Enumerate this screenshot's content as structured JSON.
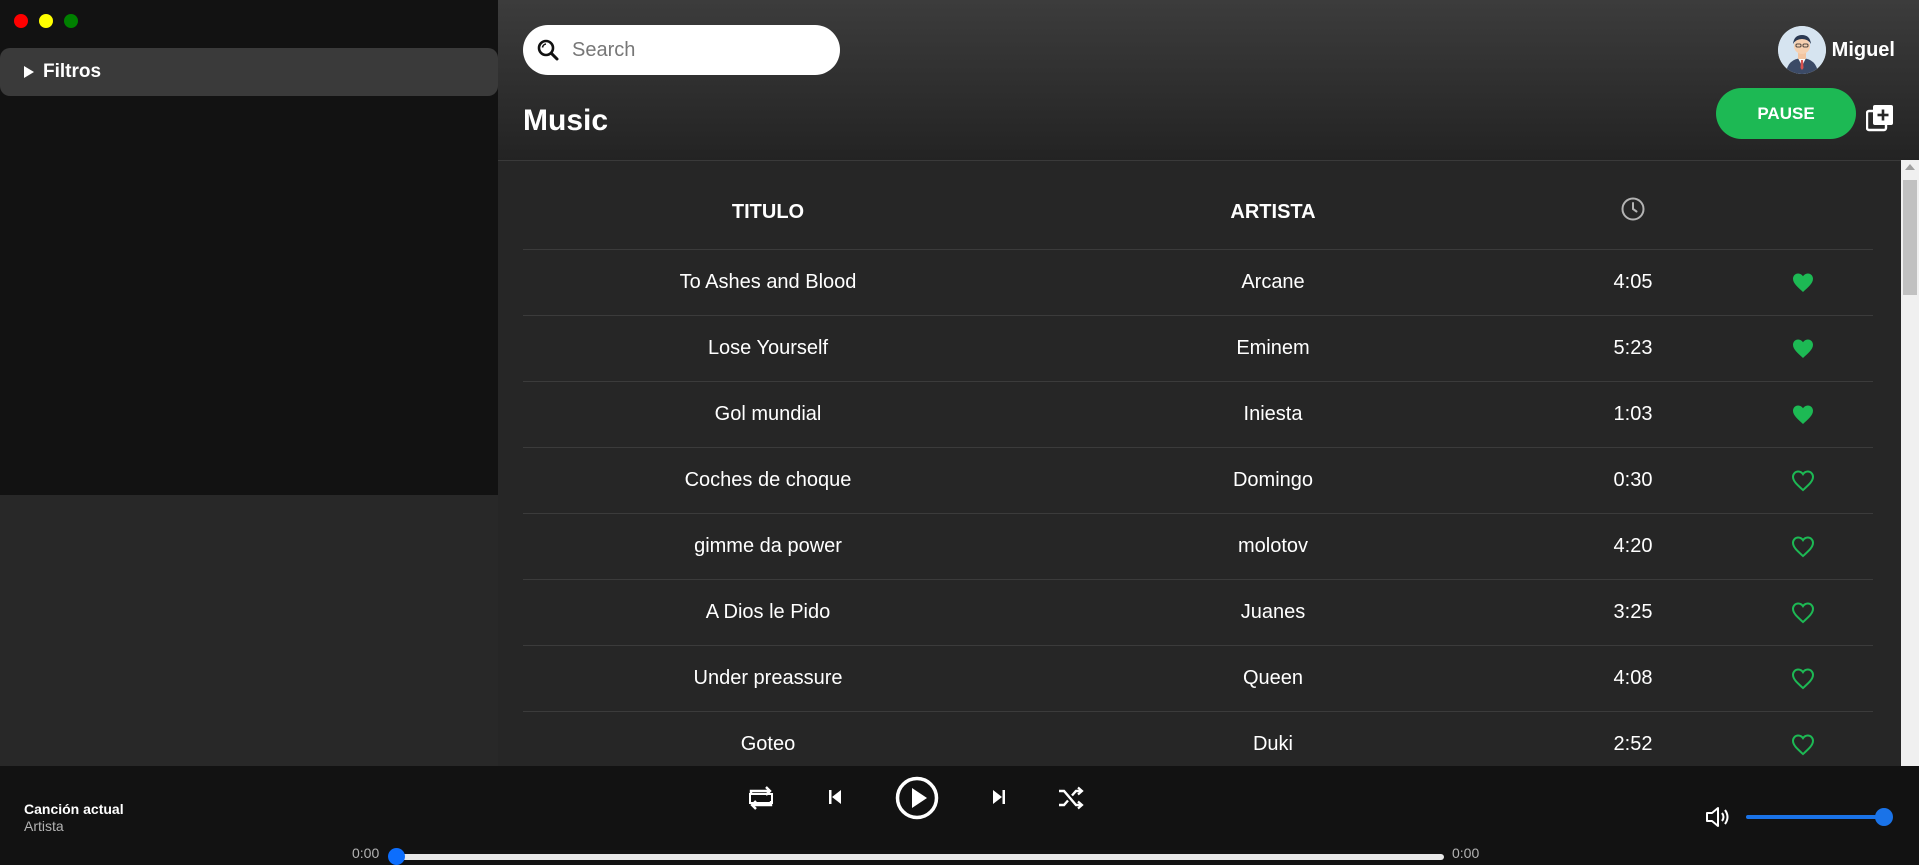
{
  "window": {
    "controls": [
      "close",
      "minimize",
      "maximize"
    ]
  },
  "sidebar": {
    "filters_label": "Filtros"
  },
  "header": {
    "search": {
      "placeholder": "Search",
      "value": ""
    },
    "title": "Music",
    "user": {
      "name": "Miguel"
    },
    "pause_label": "PAUSE"
  },
  "table": {
    "columns": {
      "title": "TITULO",
      "artist": "ARTISTA",
      "duration_icon": "clock-icon"
    },
    "rows": [
      {
        "title": "To Ashes and Blood",
        "artist": "Arcane",
        "duration": "4:05",
        "liked": true
      },
      {
        "title": "Lose Yourself",
        "artist": "Eminem",
        "duration": "5:23",
        "liked": true
      },
      {
        "title": "Gol mundial",
        "artist": "Iniesta",
        "duration": "1:03",
        "liked": true
      },
      {
        "title": "Coches de choque",
        "artist": "Domingo",
        "duration": "0:30",
        "liked": false
      },
      {
        "title": "gimme da power",
        "artist": "molotov",
        "duration": "4:20",
        "liked": false
      },
      {
        "title": "A Dios le Pido",
        "artist": "Juanes",
        "duration": "3:25",
        "liked": false
      },
      {
        "title": "Under preassure",
        "artist": "Queen",
        "duration": "4:08",
        "liked": false
      },
      {
        "title": "Goteo",
        "artist": "Duki",
        "duration": "2:52",
        "liked": false
      }
    ]
  },
  "player": {
    "current_song": "Canción actual",
    "current_artist": "Artista",
    "time_elapsed": "0:00",
    "time_total": "0:00",
    "progress": 0,
    "volume": 1.0
  },
  "colors": {
    "accent": "#1db954",
    "slider": "#1a73e8",
    "background": "#121212"
  }
}
